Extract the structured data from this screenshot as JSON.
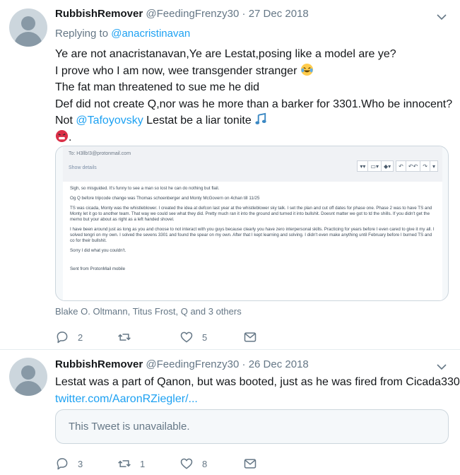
{
  "tweets": [
    {
      "author_name": "RubbishRemover",
      "author_handle": "@FeedingFrenzy30",
      "separator": "·",
      "date": "27 Dec 2018",
      "replying_prefix": "Replying to ",
      "replying_mention": "@anacristinavan",
      "lines": [
        "Ye are not anacristanavan,Ye are Lestat,posing like a model are ye?",
        "I prove who I am now, wee transgender stranger",
        "The fat man threatened to sue me he did",
        "Def did not create Q,nor was he more than a barker for 3301.Who be innocent?",
        "Not ",
        "@Tafoyovsky",
        " Lestat be a liar tonite",
        "."
      ],
      "email": {
        "to": "To: H3llb!3@protonmail.com",
        "show_details": "Show details",
        "paragraphs": [
          "Sigh, so misguided. It's funny to see a man so lost he can do nothing but flail.",
          "Og Q before tripcode change was Thomas schoenberger and Monty McGovern on 4chan till 11/25",
          "TS was cicada, Monty was the whistleblower. I created the idea at defcon last year at the whistleblower sky talk. I set the plan and cut off dates for phase one. Phase 2 was to have TS and Monty let it go to another team. That way we could see what they did. Pretty much ran it into the ground and turned it into bullshit. Doesnt matter we got to td the shills. If you didn't get the memo but your about as right as a left handed shovel.",
          "I have been around just as long as you and choose to not interact with you guys because clearly you have zero interpersonal skills. Practicing for years before I even cared to give it my all. I solved tengri on my own. I solved the sevens 3301 and found the spear on my own. After that I kept learning and solving. I didn't even make anything until February before I burned TS and co for their bullshit.",
          "Sorry I did what you couldn't.",
          "Sent from ProtonMail mobile"
        ]
      },
      "tagged": "Blake O. Oltmann, Titus Frost, Q and 3 others",
      "reply_count": "2",
      "retweet_count": "",
      "like_count": "5"
    },
    {
      "author_name": "RubbishRemover",
      "author_handle": "@FeedingFrenzy30",
      "separator": "·",
      "date": "26 Dec 2018",
      "line1": "Lestat was a part of Qanon, but was booted, just as he was fired from Cicada3301",
      "link": "twitter.com/AaronRZiegler/...",
      "unavailable": "This Tweet is unavailable.",
      "reply_count": "3",
      "retweet_count": "1",
      "like_count": "8"
    }
  ],
  "icons": {
    "reply": "reply-icon",
    "retweet": "retweet-icon",
    "like": "heart-icon",
    "share": "share-icon",
    "more": "chevron-down-icon",
    "avatar": "default-avatar-icon"
  },
  "colors": {
    "link": "#1da1f2",
    "muted": "#657786",
    "text": "#14171a",
    "border": "#e6ecf0"
  }
}
